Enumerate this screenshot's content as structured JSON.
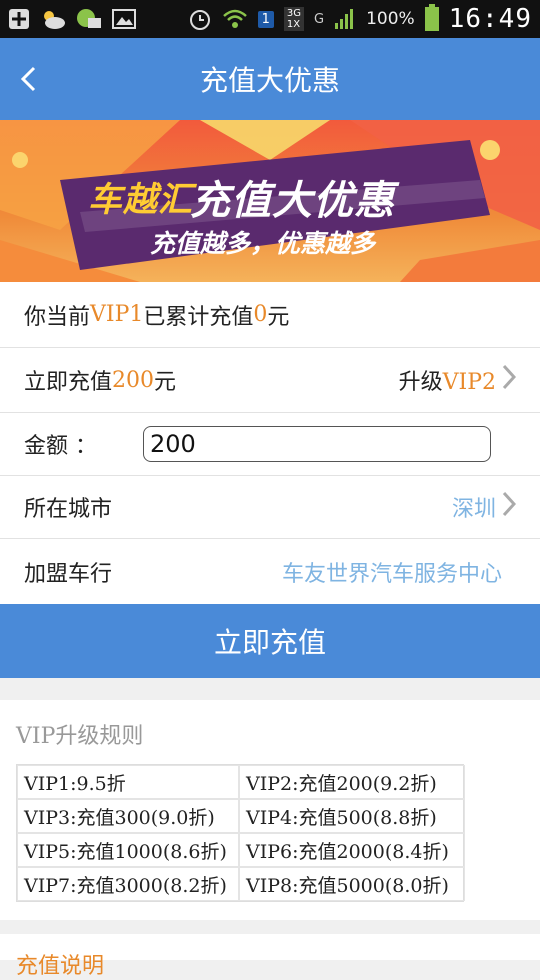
{
  "status_bar": {
    "time": "16:49",
    "battery_percent": "100%",
    "network_label_top": "3G",
    "network_label_bottom": "1X",
    "carrier_letter": "G",
    "sim_label": "1",
    "icons": [
      "add-icon",
      "weather-icon",
      "messenger-icon",
      "image-icon",
      "alarm-icon",
      "wifi-icon",
      "sim-icon",
      "signal-icon",
      "battery-icon"
    ]
  },
  "header": {
    "title": "充值大优惠",
    "back_icon": "back-chevron-icon"
  },
  "banner": {
    "brand": "车越汇",
    "headline": "充值大优惠",
    "subline": "充值越多，优惠越多",
    "colors": {
      "background_top": "#f25a3c",
      "background_bottom": "#f5b25a",
      "ribbon": "#5a2a6e",
      "brand_text": "#ffcc33"
    }
  },
  "account": {
    "prefix": "你当前",
    "level": "VIP1",
    "middle": "已累计充值",
    "amount": "0",
    "suffix": "元"
  },
  "recharge_row": {
    "prefix": "立即充值",
    "amount": "200",
    "suffix": "元",
    "upgrade_prefix": "升级",
    "upgrade_level": "VIP2"
  },
  "amount_field": {
    "label": "金额 ：",
    "value": "200"
  },
  "city_row": {
    "label": "所在城市",
    "value": "深圳"
  },
  "partner_row": {
    "label": "加盟车行",
    "value": "车友世界汽车服务中心"
  },
  "submit_button": {
    "label": "立即充值"
  },
  "rules": {
    "title": "VIP升级规则",
    "items": [
      "VIP1:9.5折",
      "VIP2:充值200(9.2折)",
      "VIP3:充值300(9.0折)",
      "VIP4:充值500(8.8折)",
      "VIP5:充值1000(8.6折)",
      "VIP6:充值2000(8.4折)",
      "VIP7:充值3000(8.2折)",
      "VIP8:充值5000(8.0折)"
    ]
  },
  "bottom_section": {
    "title": "充值说明"
  },
  "colors": {
    "primary": "#4a8ad8",
    "highlight": "#e8892a",
    "link": "#7fb4e2"
  }
}
